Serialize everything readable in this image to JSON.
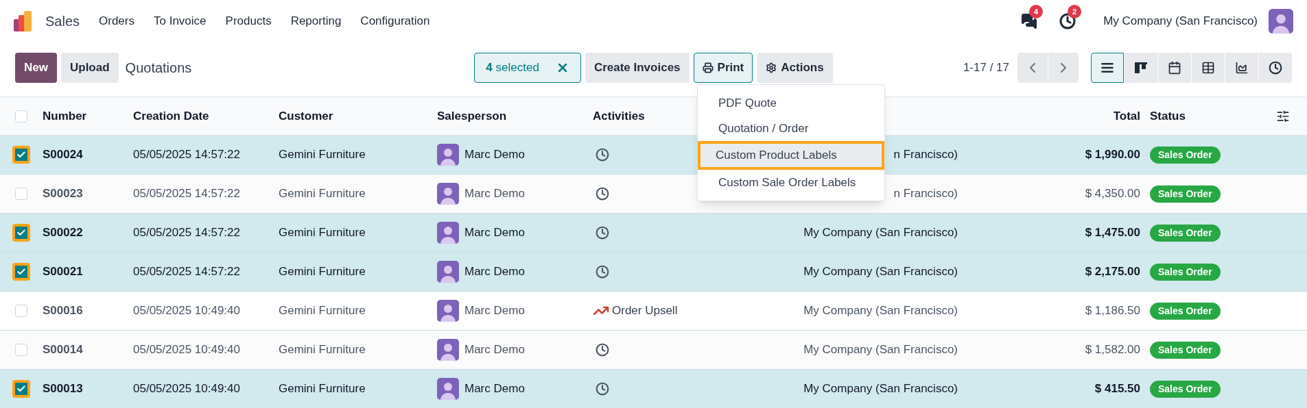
{
  "app": {
    "name": "Sales",
    "menu": [
      "Orders",
      "To Invoice",
      "Products",
      "Reporting",
      "Configuration"
    ]
  },
  "systray": {
    "messages_badge": "4",
    "activities_badge": "2",
    "company": "My Company (San Francisco)"
  },
  "control_panel": {
    "buttons": [
      "New",
      "Upload"
    ],
    "breadcrumb": "Quotations",
    "selection": {
      "count": "4",
      "label": "selected"
    },
    "actions": [
      {
        "kind": "plain",
        "label": "Create Invoices",
        "open": false
      },
      {
        "kind": "print",
        "label": "Print",
        "open": true
      },
      {
        "kind": "gear",
        "label": "Actions",
        "open": false
      }
    ],
    "pager": "1-17 / 17",
    "views": [
      {
        "kind": "list",
        "selected": true
      },
      {
        "kind": "kanban",
        "selected": false
      },
      {
        "kind": "calendar",
        "selected": false
      },
      {
        "kind": "pivot",
        "selected": false
      },
      {
        "kind": "graph",
        "selected": false
      },
      {
        "kind": "activity",
        "selected": false
      }
    ]
  },
  "print_menu": [
    {
      "label": "PDF Quote",
      "selected": false
    },
    {
      "label": "Quotation / Order",
      "selected": false
    },
    {
      "label": "Custom Product Labels",
      "selected": true
    },
    {
      "label": "Custom Sale Order Labels",
      "selected": false
    }
  ],
  "table": {
    "all_checked": false,
    "columns": [
      "Number",
      "Creation Date",
      "Customer",
      "Salesperson",
      "Activities",
      "Total",
      "Status"
    ],
    "rows": [
      {
        "checked": true,
        "number": "S00024",
        "date": "05/05/2025 14:57:22",
        "customer": "Gemini Furniture",
        "salesperson": "Marc Demo",
        "activity": {
          "kind": "clock"
        },
        "company": "n Francisco)",
        "total": "$ 1,990.00",
        "status": "Sales Order"
      },
      {
        "checked": false,
        "number": "S00023",
        "date": "05/05/2025 14:57:22",
        "customer": "Gemini Furniture",
        "salesperson": "Marc Demo",
        "activity": {
          "kind": "clock"
        },
        "company": "n Francisco)",
        "total": "$ 4,350.00",
        "status": "Sales Order"
      },
      {
        "checked": true,
        "number": "S00022",
        "date": "05/05/2025 14:57:22",
        "customer": "Gemini Furniture",
        "salesperson": "Marc Demo",
        "activity": {
          "kind": "clock"
        },
        "company": "My Company (San Francisco)",
        "total": "$ 1,475.00",
        "status": "Sales Order"
      },
      {
        "checked": true,
        "number": "S00021",
        "date": "05/05/2025 14:57:22",
        "customer": "Gemini Furniture",
        "salesperson": "Marc Demo",
        "activity": {
          "kind": "clock"
        },
        "company": "My Company (San Francisco)",
        "total": "$ 2,175.00",
        "status": "Sales Order"
      },
      {
        "checked": false,
        "number": "S00016",
        "date": "05/05/2025 10:49:40",
        "customer": "Gemini Furniture",
        "salesperson": "Marc Demo",
        "activity": {
          "kind": "upsell",
          "label": "Order Upsell"
        },
        "company": "My Company (San Francisco)",
        "total": "$ 1,186.50",
        "status": "Sales Order"
      },
      {
        "checked": false,
        "number": "S00014",
        "date": "05/05/2025 10:49:40",
        "customer": "Gemini Furniture",
        "salesperson": "Marc Demo",
        "activity": {
          "kind": "clock"
        },
        "company": "My Company (San Francisco)",
        "total": "$ 1,582.00",
        "status": "Sales Order"
      },
      {
        "checked": true,
        "number": "S00013",
        "date": "05/05/2025 10:49:40",
        "customer": "Gemini Furniture",
        "salesperson": "Marc Demo",
        "activity": {
          "kind": "clock"
        },
        "company": "My Company (San Francisco)",
        "total": "$ 415.50",
        "status": "Sales Order"
      }
    ]
  }
}
